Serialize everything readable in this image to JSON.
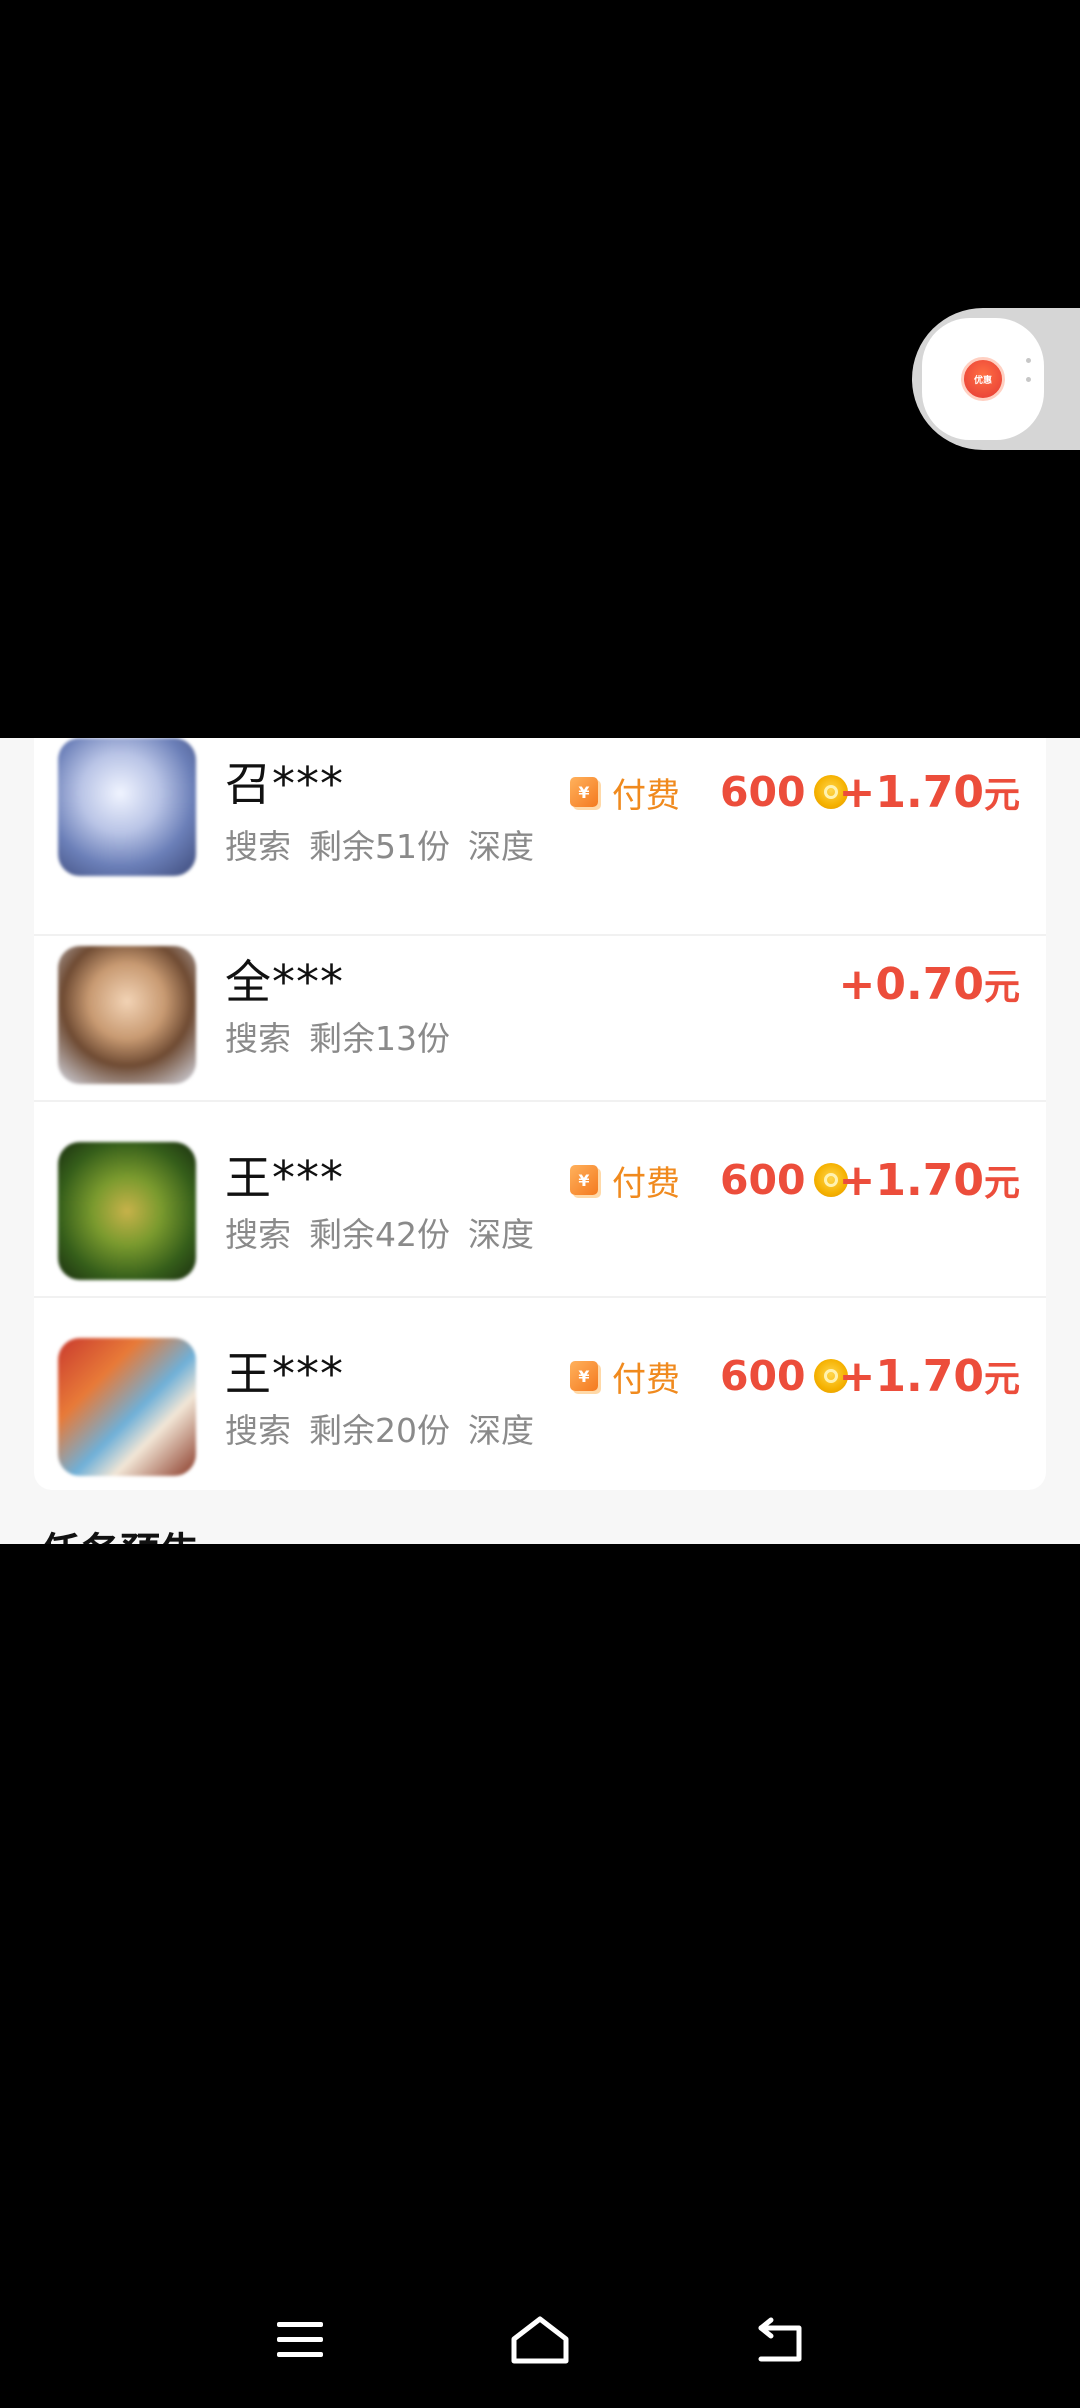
{
  "floating_button": {
    "logo_text": "优惠"
  },
  "tasks": [
    {
      "name": "召***",
      "tags": [
        "搜索",
        "剩余51份",
        "深度"
      ],
      "paid_label": "付费",
      "paid_icon": "¥",
      "coins": "600",
      "reward": "+1.70",
      "reward_unit": "元"
    },
    {
      "name": "全***",
      "tags": [
        "搜索",
        "剩余13份"
      ],
      "paid_label": "",
      "paid_icon": "",
      "coins": "",
      "reward": "+0.70",
      "reward_unit": "元"
    },
    {
      "name": "王***",
      "tags": [
        "搜索",
        "剩余42份",
        "深度"
      ],
      "paid_label": "付费",
      "paid_icon": "¥",
      "coins": "600",
      "reward": "+1.70",
      "reward_unit": "元"
    },
    {
      "name": "王***",
      "tags": [
        "搜索",
        "剩余20份",
        "深度"
      ],
      "paid_label": "付费",
      "paid_icon": "¥",
      "coins": "600",
      "reward": "+1.70",
      "reward_unit": "元"
    }
  ],
  "section": {
    "title": "任务预告"
  },
  "colors": {
    "accent_red": "#ec4d3b",
    "accent_orange": "#f08a1e",
    "coin_gold": "#f5b100"
  }
}
